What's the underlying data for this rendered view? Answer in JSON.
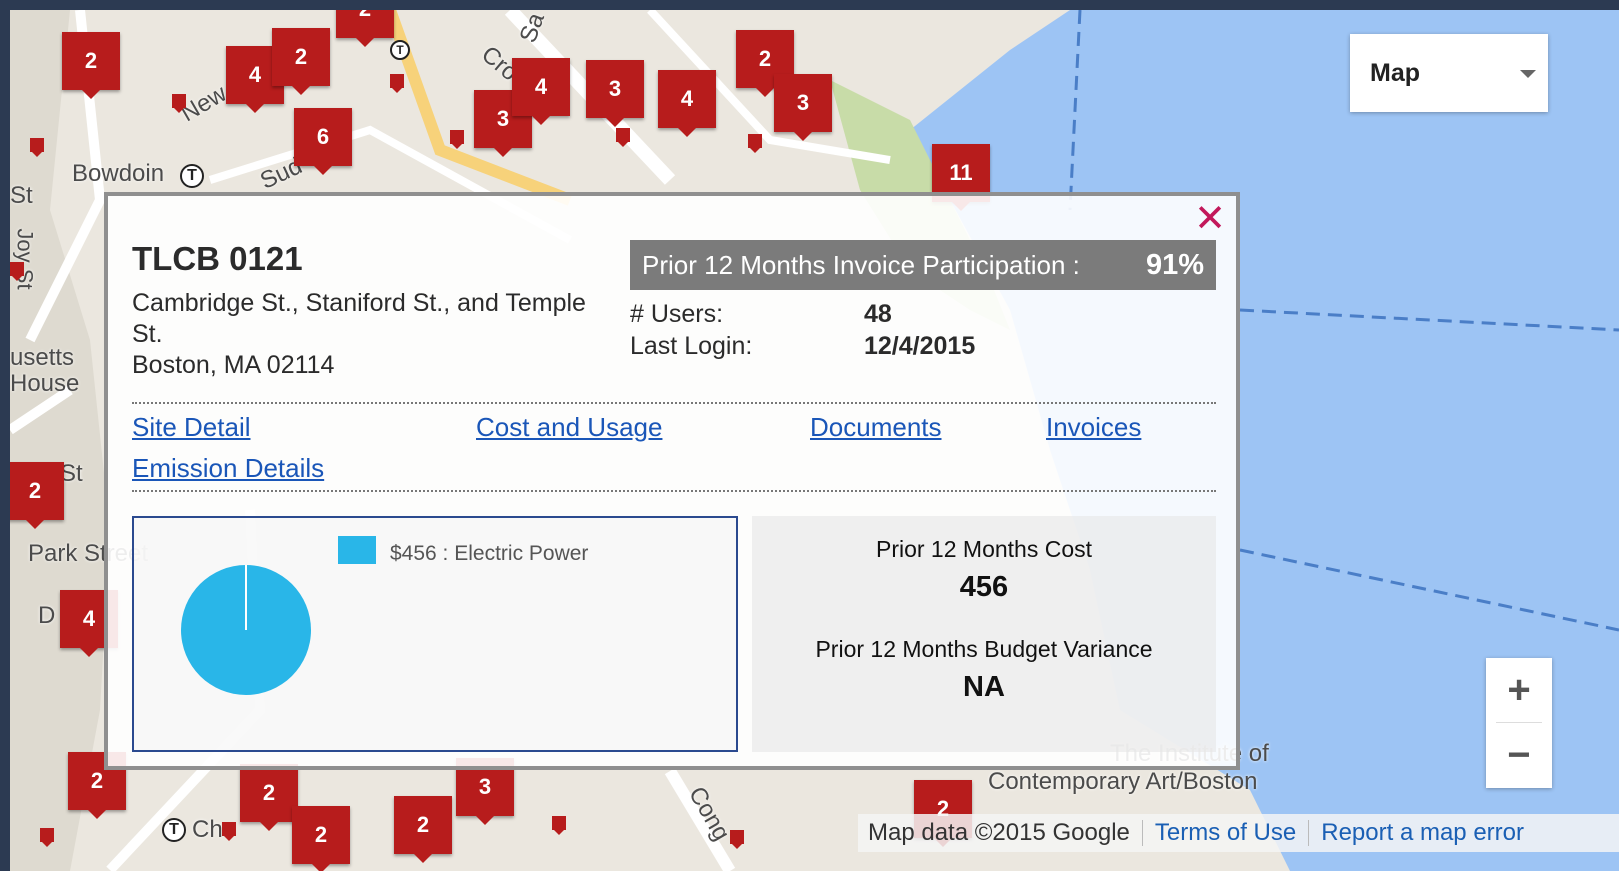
{
  "map": {
    "labels": [
      "Bowdoin",
      "St",
      "Joy St",
      "usetts",
      "House",
      "St",
      "Park Street",
      "D",
      "Ch",
      "Cong",
      "The Institute of",
      "Contemporary Art/Boston",
      "New",
      "Sud",
      "Cro",
      "Sa"
    ],
    "markers": [
      "2",
      "4",
      "2",
      "2",
      "6",
      "3",
      "4",
      "3",
      "4",
      "2",
      "3",
      "11",
      "2",
      "4",
      "2",
      "2",
      "2",
      "3",
      "2",
      "2"
    ],
    "map_type": {
      "label": "Map"
    },
    "zoom": {
      "in": "+",
      "out": "−"
    },
    "attribution": {
      "text": "Map data ©2015 Google",
      "terms": "Terms of Use",
      "report": "Report a map error"
    }
  },
  "popup": {
    "close": "✕",
    "site_name": "TLCB 0121",
    "address_line1": "Cambridge St., Staniford St., and Temple St.",
    "address_line2": "Boston, MA 02114",
    "participation": {
      "label": "Prior 12 Months Invoice Participation :",
      "value": "91%"
    },
    "stats": [
      {
        "label": "# Users:",
        "value": "48"
      },
      {
        "label": "Last Login:",
        "value": "12/4/2015"
      }
    ],
    "links": {
      "site_detail": "Site Detail",
      "cost_usage": "Cost and Usage",
      "documents": "Documents",
      "invoices": "Invoices",
      "emission": "Emission Details"
    },
    "cost": {
      "label": "Prior 12 Months Cost",
      "value": "456"
    },
    "budget": {
      "label": "Prior 12 Months Budget Variance",
      "value": "NA"
    }
  },
  "chart_data": {
    "type": "pie",
    "categories": [
      "Electric Power"
    ],
    "values": [
      456
    ],
    "legend": [
      "$456 : Electric Power"
    ],
    "colors": [
      "#29b6e8"
    ],
    "legend_position": "top-right"
  }
}
